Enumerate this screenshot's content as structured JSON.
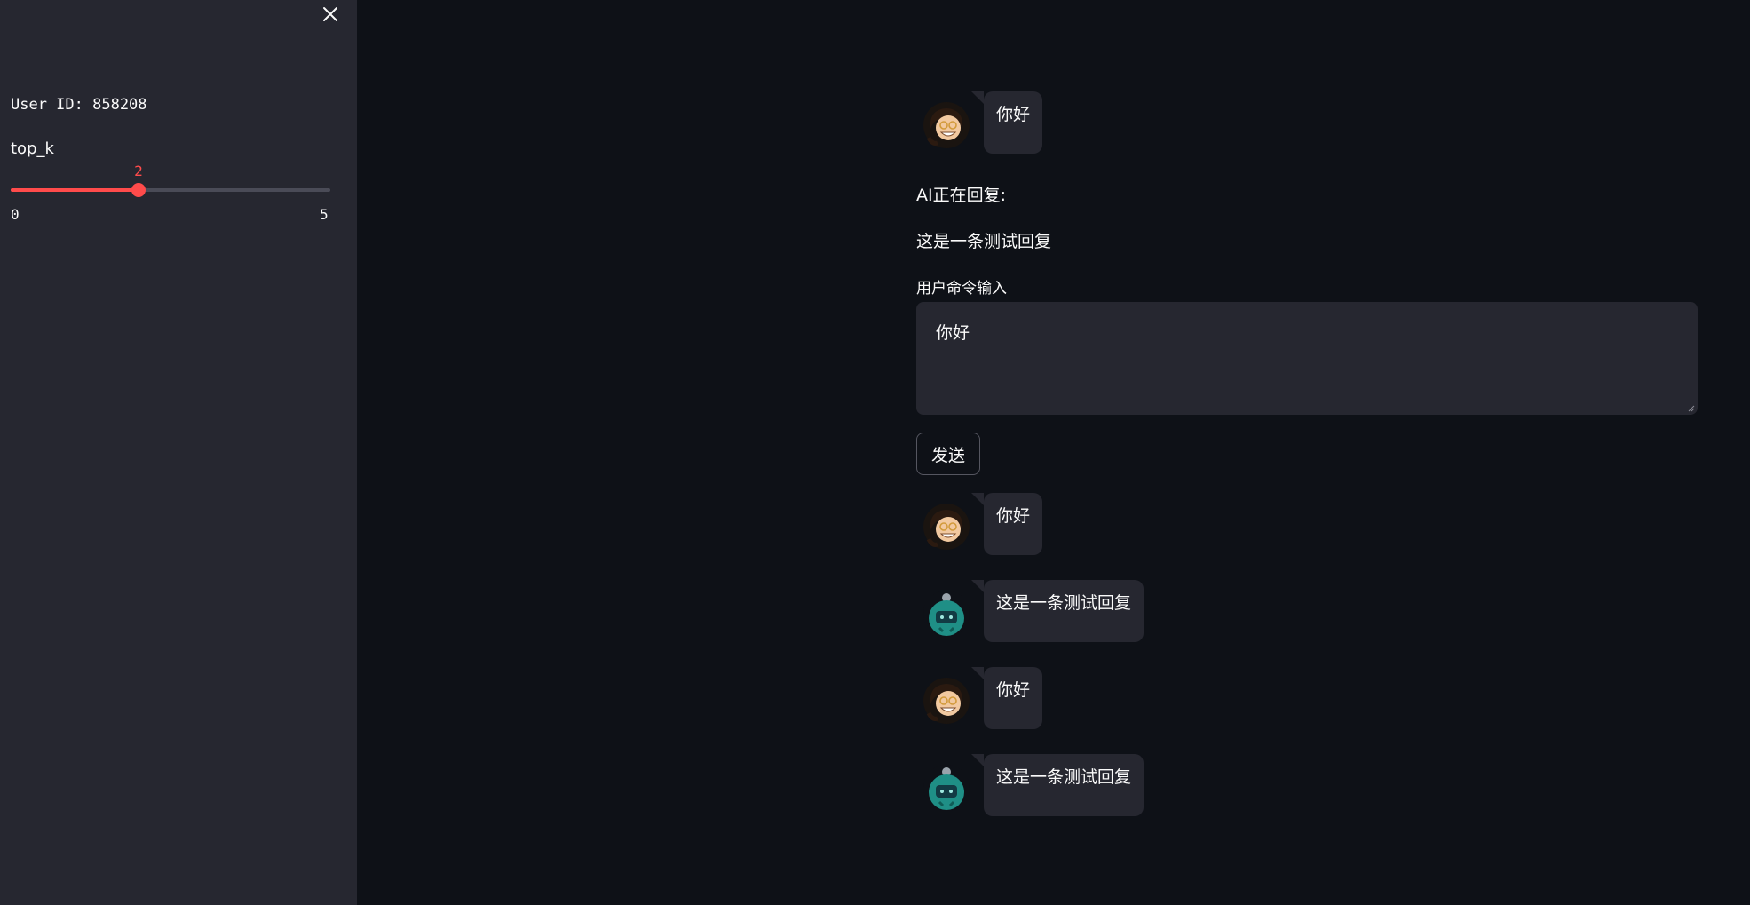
{
  "sidebar": {
    "close_icon": "close-icon",
    "user_id_text": "User ID: 858208",
    "slider": {
      "label": "top_k",
      "value": 2,
      "value_text": "2",
      "min": 0,
      "max": 5,
      "min_text": "0",
      "max_text": "5",
      "accent_color": "#ff4b4b"
    }
  },
  "main": {
    "first_user_message": {
      "avatar": "user-avatar-icon",
      "text": "你好"
    },
    "status_text": "AI正在回复:",
    "reply_preview": "这是一条测试回复",
    "input": {
      "label": "用户命令输入",
      "value": "你好"
    },
    "send_button_label": "发送",
    "history": [
      {
        "role": "user",
        "avatar": "user-avatar-icon",
        "text": "你好"
      },
      {
        "role": "assistant",
        "avatar": "robot-avatar-icon",
        "text": "这是一条测试回复"
      },
      {
        "role": "user",
        "avatar": "user-avatar-icon",
        "text": "你好"
      },
      {
        "role": "assistant",
        "avatar": "robot-avatar-icon",
        "text": "这是一条测试回复"
      }
    ]
  },
  "colors": {
    "background": "#0e1117",
    "sidebar": "#262730",
    "bubble": "#262730",
    "accent": "#ff4b4b"
  }
}
